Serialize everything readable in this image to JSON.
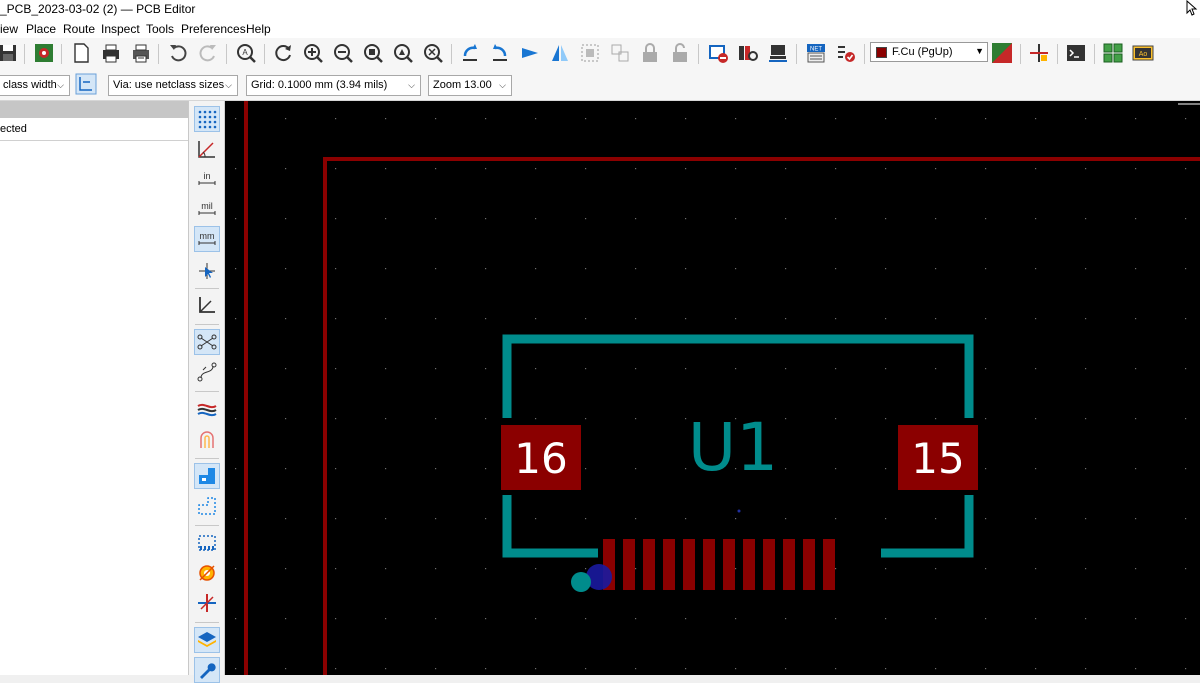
{
  "window": {
    "title": "_PCB_2023-03-02 (2) — PCB Editor"
  },
  "menu": {
    "items": [
      "iew",
      "Place",
      "Route",
      "Inspect",
      "Tools",
      "Preferences",
      "Help"
    ]
  },
  "toolbar": {
    "layer_label": "F.Cu (PgUp)",
    "layer_color": "#8b0000"
  },
  "toolbar2": {
    "track_width": "class width",
    "via_size": "Via: use netclass sizes",
    "grid": "Grid: 0.1000 mm (3.94 mils)",
    "zoom": "Zoom 13.00"
  },
  "left_panel": {
    "status": "ected"
  },
  "vertical_toolbar": {
    "inch_label": "in",
    "mil_label": "mil",
    "mm_label": "mm"
  },
  "pcb": {
    "component_ref": "U1",
    "pad_left": "16",
    "pad_right": "15",
    "board_edge_color": "#8b0000",
    "silkscreen_color": "#008c8c",
    "pad_color": "#8b0000",
    "pad_text_color": "#ffffff",
    "fine_pitch_pad_count": 12
  }
}
